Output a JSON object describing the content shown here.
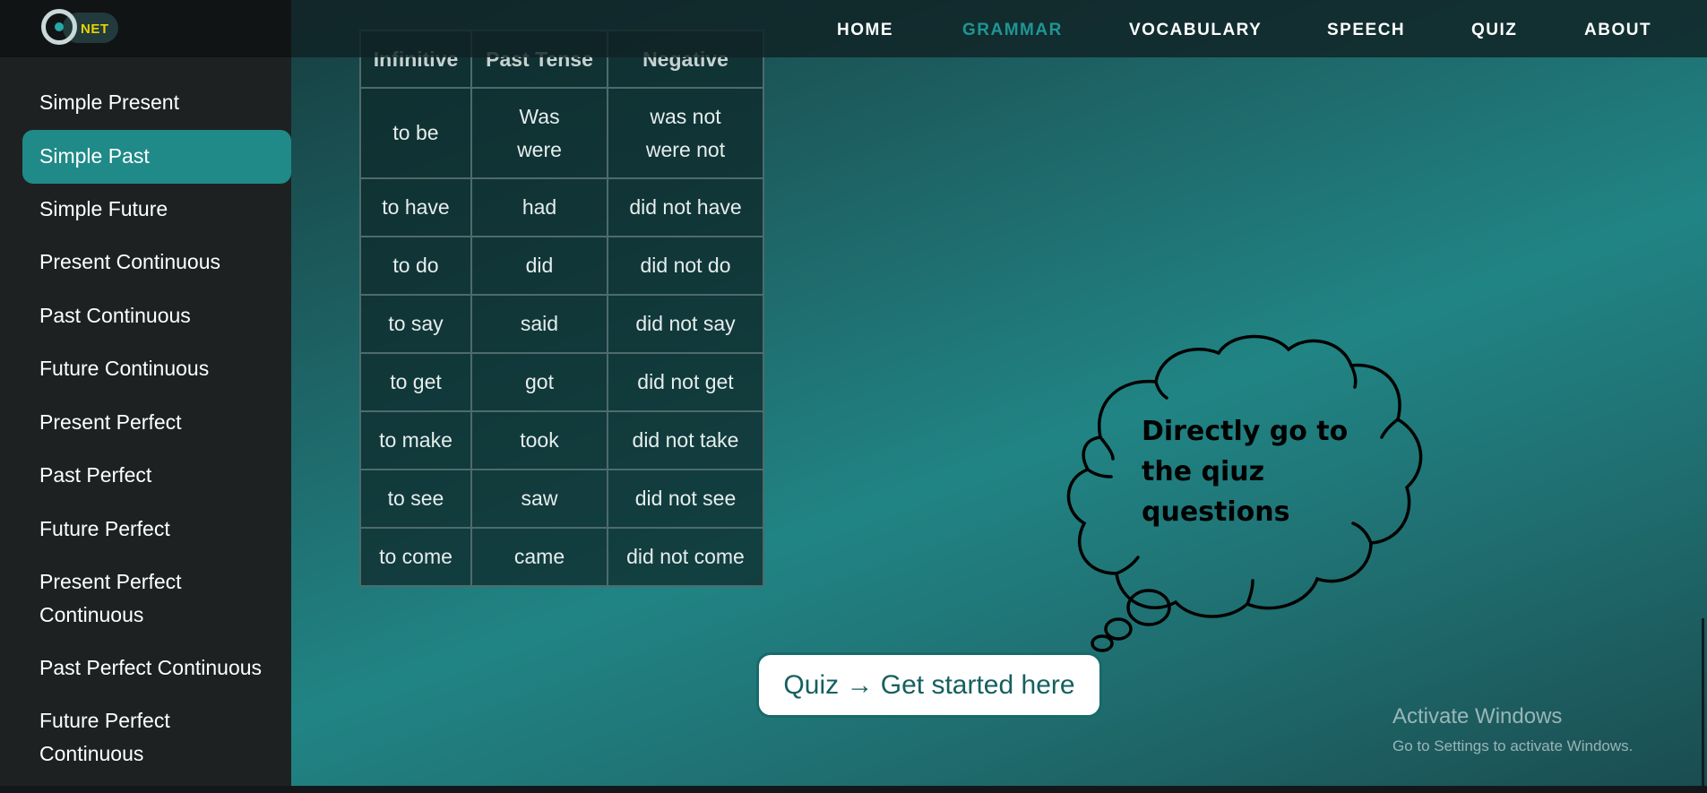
{
  "navbar": {
    "logo_text": "NET",
    "links": [
      {
        "label": "HOME",
        "active": false
      },
      {
        "label": "GRAMMAR",
        "active": true
      },
      {
        "label": "VOCABULARY",
        "active": false
      },
      {
        "label": "SPEECH",
        "active": false
      },
      {
        "label": "QUIZ",
        "active": false
      },
      {
        "label": "ABOUT",
        "active": false
      }
    ]
  },
  "sidebar": {
    "items": [
      {
        "label": "Simple Present"
      },
      {
        "label": "Simple Past",
        "active": true
      },
      {
        "label": "Simple Future"
      },
      {
        "label": "Present Continuous"
      },
      {
        "label": "Past Continuous"
      },
      {
        "label": "Future Continuous"
      },
      {
        "label": "Present Perfect"
      },
      {
        "label": "Past Perfect"
      },
      {
        "label": "Future Perfect"
      },
      {
        "label": "Present Perfect Continuous",
        "line1": "Present Perfect",
        "line2": "Continuous"
      },
      {
        "label": "Past Perfect Continuous"
      },
      {
        "label": "Future Perfect Continuous",
        "line1": "Future Perfect",
        "line2": "Continuous"
      }
    ]
  },
  "table": {
    "headers": [
      "Infinitive",
      "Past Tense",
      "Negative"
    ],
    "rows": [
      {
        "infinitive": "to be",
        "past1": "Was",
        "past2": "were",
        "neg1": "was not",
        "neg2": "were not"
      },
      {
        "infinitive": "to have",
        "past": "had",
        "negative": "did not have"
      },
      {
        "infinitive": "to do",
        "past": "did",
        "negative": "did not do"
      },
      {
        "infinitive": "to say",
        "past": "said",
        "negative": "did not say"
      },
      {
        "infinitive": "to get",
        "past": "got",
        "negative": "did not get"
      },
      {
        "infinitive": "to make",
        "past": "took",
        "negative": "did not take"
      },
      {
        "infinitive": "to see",
        "past": "saw",
        "negative": "did not see"
      },
      {
        "infinitive": "to come",
        "past": "came",
        "negative": "did not come"
      }
    ]
  },
  "callout": {
    "line1": "Directly go to",
    "line2": "the qiuz",
    "line3": "questions"
  },
  "quiz_button": {
    "label": "Quiz → Get started here"
  },
  "activate_windows": {
    "title": "Activate Windows",
    "subtitle": "Go to Settings to activate Windows."
  },
  "colors": {
    "accent": "#1f8a88",
    "active_nav": "#1f9694",
    "sidebar_bg": "#1e2122",
    "button_text": "#15605f"
  }
}
